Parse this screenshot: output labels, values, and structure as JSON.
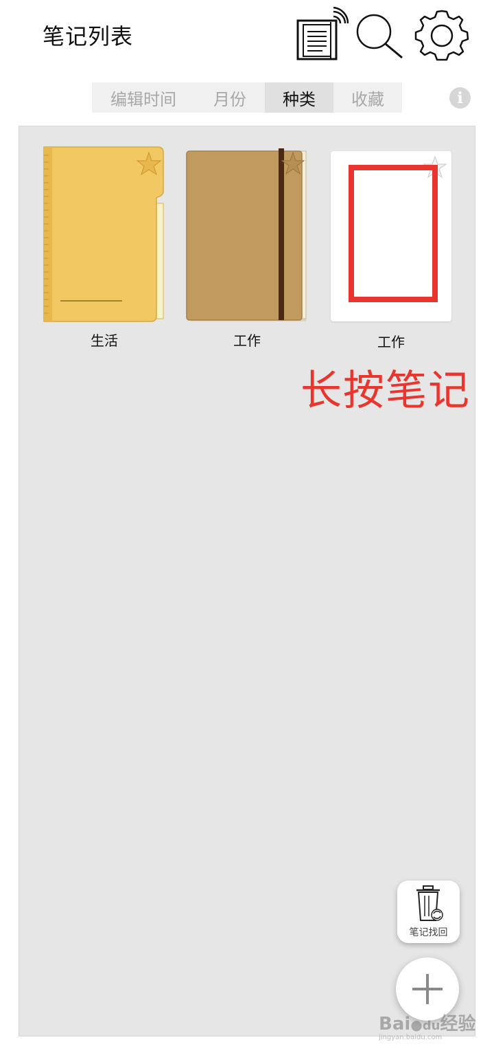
{
  "header": {
    "title": "笔记列表",
    "icons": [
      "notebook-wifi-icon",
      "search-icon",
      "gear-icon"
    ]
  },
  "tabs": [
    {
      "label": "编辑时间",
      "active": false
    },
    {
      "label": "月份",
      "active": false
    },
    {
      "label": "种类",
      "active": true
    },
    {
      "label": "收藏",
      "active": false
    }
  ],
  "info_icon": "i",
  "notes": [
    {
      "label": "生活",
      "cover": "yellow-folder",
      "starred": false
    },
    {
      "label": "工作",
      "cover": "brown-notebook",
      "starred": false
    },
    {
      "label": "工作",
      "cover": "white-blank",
      "starred": false
    }
  ],
  "annotation": {
    "text": "长按笔记",
    "color": "#e8352d"
  },
  "recover_button": {
    "label": "笔记找回"
  },
  "add_button": {
    "icon": "plus-icon"
  },
  "watermark": {
    "brand": "Bai",
    "brand2": "du",
    "suffix": "经验",
    "url": "jingyan.baidu.com"
  },
  "colors": {
    "accent_red": "#e8352d",
    "content_bg": "#e6e6e6",
    "tab_active_bg": "#e0e0e0"
  }
}
